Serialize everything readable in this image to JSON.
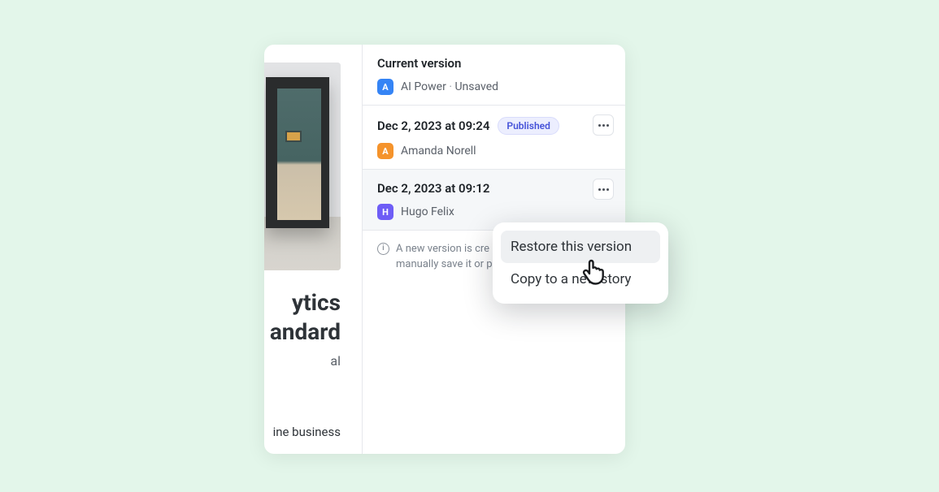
{
  "content": {
    "headline_frag1": "ytics",
    "headline_frag2": "andard",
    "sub_frag": "al",
    "body_frag": "ine business"
  },
  "versions": {
    "current": {
      "title": "Current version",
      "user_initial": "A",
      "user_name": "AI Power",
      "status": "Unsaved"
    },
    "items": [
      {
        "timestamp": "Dec 2, 2023 at 09:24",
        "badge": "Published",
        "user_initial": "A",
        "user_name": "Amanda Norell"
      },
      {
        "timestamp": "Dec 2, 2023 at 09:12",
        "user_initial": "H",
        "user_name": "Hugo Felix"
      }
    ],
    "info_line1": "A new version is cre",
    "info_line2": "manually save it or p"
  },
  "popover": {
    "restore": "Restore this version",
    "copy": "Copy to a new story"
  }
}
